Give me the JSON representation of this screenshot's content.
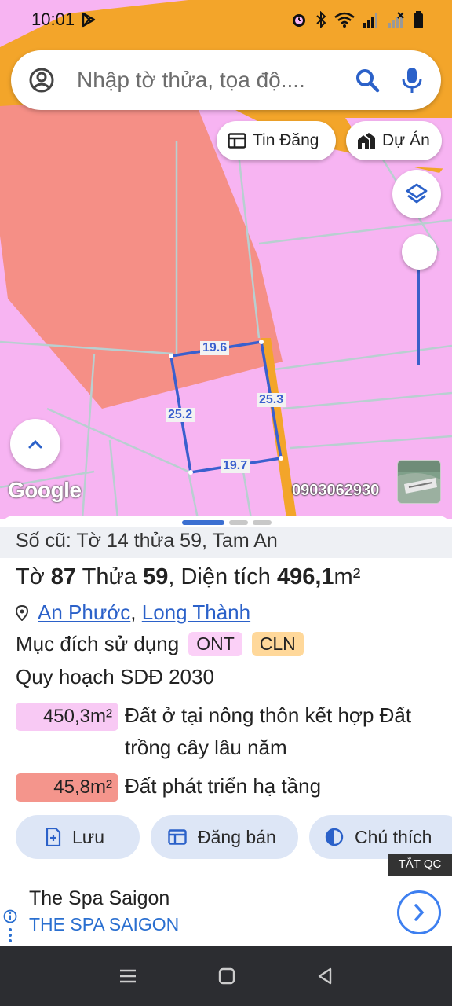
{
  "status_bar": {
    "time": "10:01"
  },
  "search": {
    "placeholder": "Nhập tờ thửa, tọa độ...."
  },
  "chips": {
    "tin_dang": "Tin Đăng",
    "du_an": "Dự Án"
  },
  "map": {
    "google_label": "Google",
    "phone_watermark": "0903062930",
    "edge_labels": {
      "top": "19.6",
      "right": "25.3",
      "bottom": "19.7",
      "left": "25.2"
    },
    "colors": {
      "residential": "#f7b4f2",
      "highway": "#f3a52a",
      "infrastructure": "#f58f86",
      "boundary": "#3a5fce"
    }
  },
  "sheet": {
    "old_info": "Số cũ: Tờ 14 thửa 59, Tam An",
    "title": {
      "to_label": "Tờ",
      "to_value": "87",
      "thua_label": "Thửa",
      "thua_value": "59",
      "area_label": ", Diện tích",
      "area_value": "496,1",
      "area_unit": "m²"
    },
    "location": {
      "ward": "An Phước",
      "sep": ",",
      "district": "Long Thành"
    },
    "purpose": {
      "label": "Mục đích sử dụng",
      "codes": [
        "ONT",
        "CLN"
      ]
    },
    "plan_title": "Quy hoạch SDĐ 2030",
    "plan_items": [
      {
        "area": "450,3m²",
        "desc": "Đất ở tại nông thôn kết hợp Đất trồng cây lâu năm",
        "color": "#f8c9f4"
      },
      {
        "area": "45,8m²",
        "desc": "Đất phát triển hạ tầng",
        "color": "#f4958c"
      }
    ],
    "actions": {
      "save": "Lưu",
      "sell": "Đăng bán",
      "legend": "Chú thích"
    }
  },
  "ad": {
    "close_label": "TẮT QC",
    "title": "The Spa Saigon",
    "subtitle": "THE SPA SAIGON"
  }
}
